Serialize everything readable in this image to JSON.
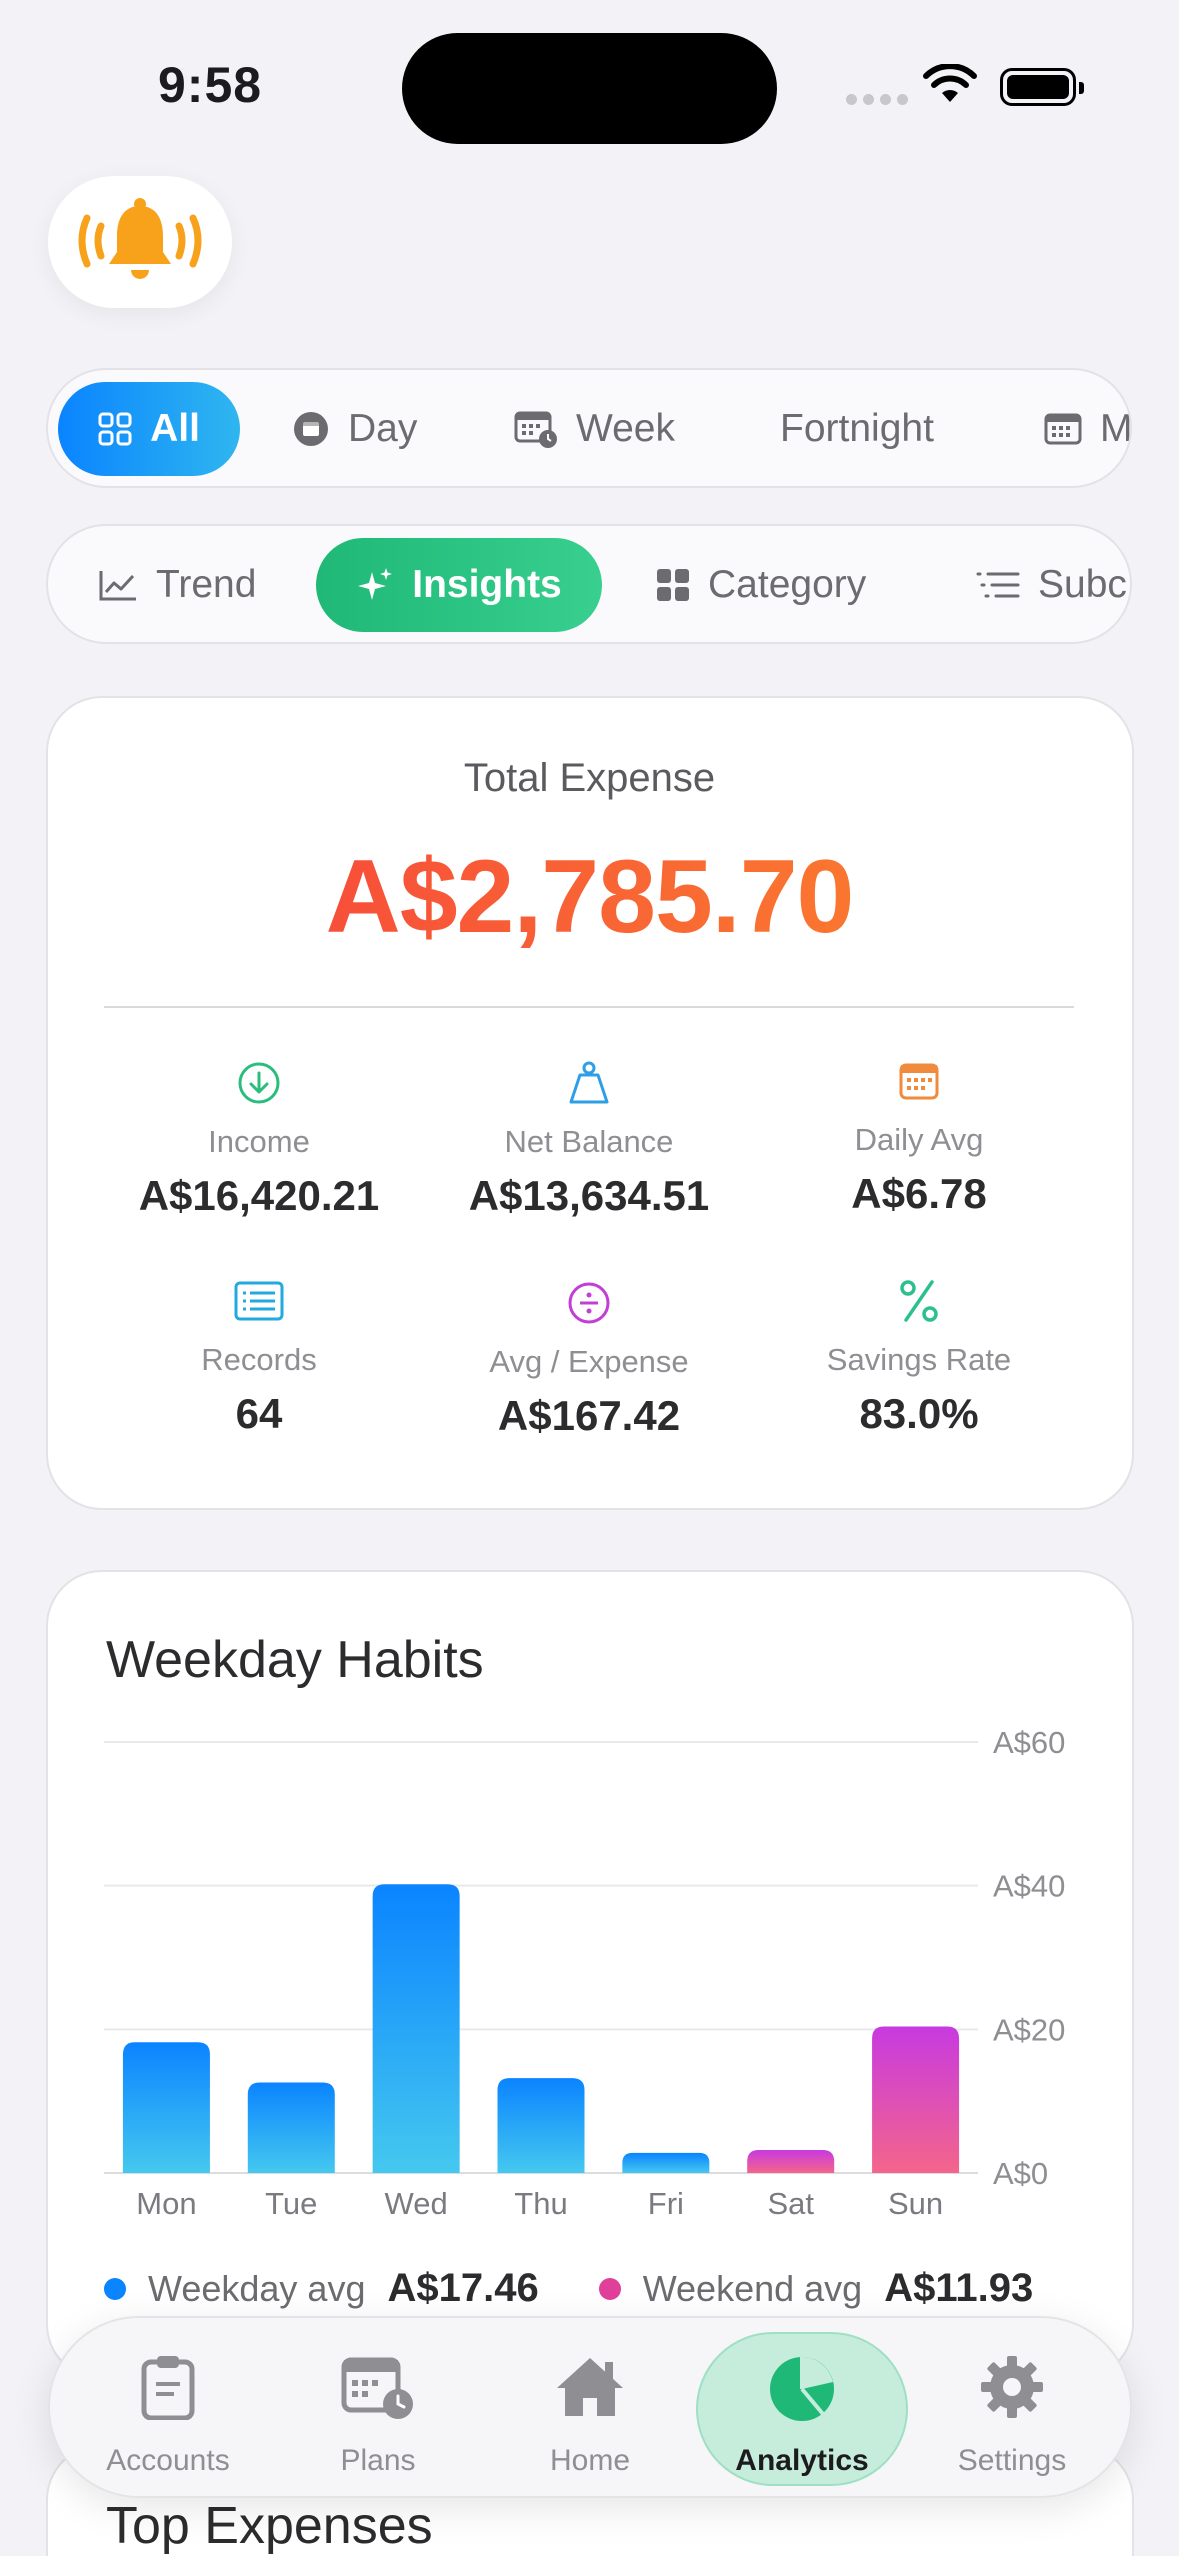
{
  "status_bar": {
    "time": "9:58"
  },
  "periods": {
    "items": [
      {
        "label": "All",
        "icon": "grid-icon",
        "active": true
      },
      {
        "label": "Day",
        "icon": "calendar-day-icon",
        "active": false
      },
      {
        "label": "Week",
        "icon": "calendar-week-icon",
        "active": false
      },
      {
        "label": "Fortnight",
        "icon": "",
        "active": false
      },
      {
        "label": "M",
        "icon": "calendar-month-icon",
        "active": false
      }
    ]
  },
  "views": {
    "items": [
      {
        "label": "Trend",
        "icon": "trend-line-icon",
        "active": false
      },
      {
        "label": "Insights",
        "icon": "sparkles-icon",
        "active": true
      },
      {
        "label": "Category",
        "icon": "category-grid-icon",
        "active": false
      },
      {
        "label": "Subc",
        "icon": "list-icon",
        "active": false
      }
    ]
  },
  "summary": {
    "total_label": "Total Expense",
    "total_value": "A$2,785.70",
    "metrics": [
      {
        "label": "Income",
        "value": "A$16,420.21",
        "icon": "arrow-down-circle-icon",
        "color": "#2bbd7e"
      },
      {
        "label": "Net Balance",
        "value": "A$13,634.51",
        "icon": "scale-icon",
        "color": "#2d9fe6"
      },
      {
        "label": "Daily Avg",
        "value": "A$6.78",
        "icon": "calendar-icon",
        "color": "#f08a3c"
      },
      {
        "label": "Records",
        "value": "64",
        "icon": "list-rectangle-icon",
        "color": "#23a8e0"
      },
      {
        "label": "Avg / Expense",
        "value": "A$167.42",
        "icon": "divide-circle-icon",
        "color": "#c23fd6"
      },
      {
        "label": "Savings Rate",
        "value": "83.0%",
        "icon": "percent-icon",
        "color": "#2bc08e"
      }
    ]
  },
  "weekday_habits": {
    "title": "Weekday Habits",
    "legend": {
      "weekday_label": "Weekday avg",
      "weekday_value": "A$17.46",
      "weekday_color": "#0a84ff",
      "weekend_label": "Weekend avg",
      "weekend_value": "A$11.93",
      "weekend_color": "#e0409a"
    }
  },
  "chart_data": {
    "type": "bar",
    "title": "Weekday Habits",
    "categories": [
      "Mon",
      "Tue",
      "Wed",
      "Thu",
      "Fri",
      "Sat",
      "Sun"
    ],
    "values": [
      18.2,
      12.6,
      40.2,
      13.2,
      2.8,
      3.2,
      20.4
    ],
    "is_weekend": [
      false,
      false,
      false,
      false,
      false,
      true,
      true
    ],
    "ylim": [
      0,
      60
    ],
    "yticks": [
      0,
      20,
      40,
      60
    ],
    "ytick_labels": [
      "A$0",
      "A$20",
      "A$40",
      "A$60"
    ],
    "grid": true,
    "colors": {
      "weekday": [
        "#0a84ff",
        "#45c8ef"
      ],
      "weekend": [
        "#c73ae0",
        "#f4658b"
      ]
    }
  },
  "top_expenses": {
    "title": "Top Expenses"
  },
  "tab_bar": {
    "items": [
      {
        "label": "Accounts",
        "icon": "clipboard-icon",
        "active": false
      },
      {
        "label": "Plans",
        "icon": "calendar-clock-icon",
        "active": false
      },
      {
        "label": "Home",
        "icon": "house-icon",
        "active": false
      },
      {
        "label": "Analytics",
        "icon": "pie-chart-icon",
        "active": true
      },
      {
        "label": "Settings",
        "icon": "gear-icon",
        "active": false
      }
    ]
  }
}
